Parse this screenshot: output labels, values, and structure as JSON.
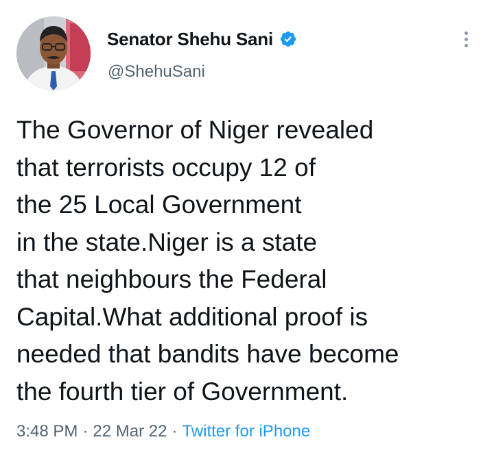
{
  "author": {
    "display_name": "Senator Shehu Sani",
    "handle": "@ShehuSani",
    "verified": true,
    "avatar_icon": "profile-photo",
    "verified_icon": "verified-badge-icon",
    "verified_color": "#1d9bf0"
  },
  "menu": {
    "icon": "more-options-icon"
  },
  "tweet": {
    "lines": [
      "The Governor of Niger revealed",
      "that terrorists occupy 12 of",
      "the 25 Local Government",
      "in the state.Niger is a state",
      "that neighbours the Federal",
      "Capital.What additional proof is",
      "needed that bandits have become",
      "the fourth tier of Government."
    ]
  },
  "meta": {
    "time": "3:48 PM",
    "separator": "·",
    "date": "22 Mar 22",
    "source": "Twitter for iPhone",
    "source_color": "#1d9bf0"
  }
}
